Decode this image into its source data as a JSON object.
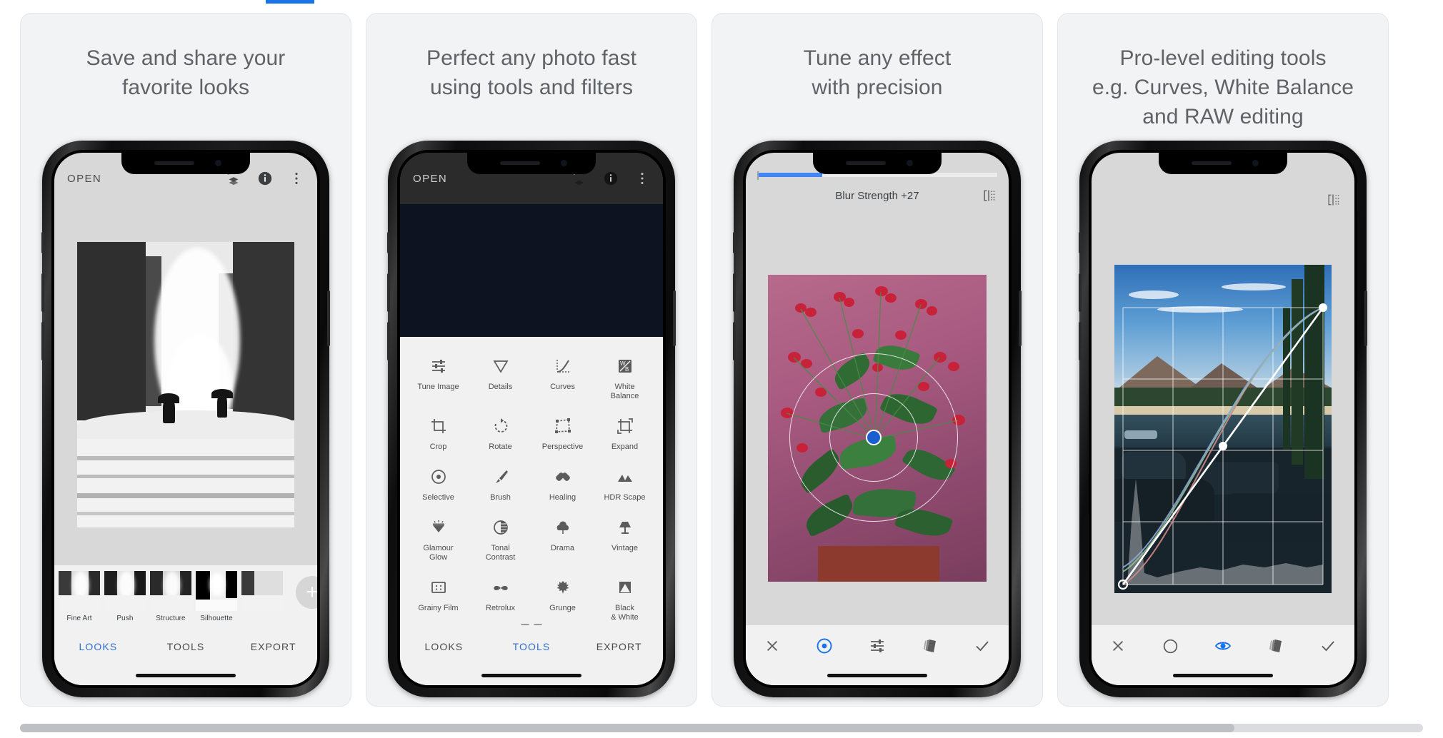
{
  "accent_color": "#1a73e8",
  "cards": [
    {
      "title": "Save and share your\nfavorite looks",
      "phone": {
        "top_bar": {
          "open_label": "OPEN",
          "icons": [
            "undo-stack-icon",
            "info-icon",
            "more-vert-icon"
          ]
        },
        "looks": [
          {
            "label": "Fine Art"
          },
          {
            "label": "Push"
          },
          {
            "label": "Structure"
          },
          {
            "label": "Silhouette"
          }
        ],
        "add_look_label": "+",
        "tabs": [
          {
            "label": "LOOKS",
            "active": true
          },
          {
            "label": "TOOLS",
            "active": false
          },
          {
            "label": "EXPORT",
            "active": false
          }
        ]
      }
    },
    {
      "title": "Perfect any photo fast\nusing tools and filters",
      "phone": {
        "top_bar": {
          "open_label": "OPEN",
          "icons": [
            "undo-stack-icon",
            "info-icon",
            "more-vert-icon"
          ]
        },
        "tools": [
          {
            "label": "Tune Image",
            "icon": "sliders-icon"
          },
          {
            "label": "Details",
            "icon": "triangle-down-icon"
          },
          {
            "label": "Curves",
            "icon": "curve-icon"
          },
          {
            "label": "White\nBalance",
            "icon": "wb-icon"
          },
          {
            "label": "Crop",
            "icon": "crop-icon"
          },
          {
            "label": "Rotate",
            "icon": "rotate-icon"
          },
          {
            "label": "Perspective",
            "icon": "perspective-icon"
          },
          {
            "label": "Expand",
            "icon": "expand-icon"
          },
          {
            "label": "Selective",
            "icon": "target-icon"
          },
          {
            "label": "Brush",
            "icon": "brush-icon"
          },
          {
            "label": "Healing",
            "icon": "healing-icon"
          },
          {
            "label": "HDR Scape",
            "icon": "mountains-icon"
          },
          {
            "label": "Glamour\nGlow",
            "icon": "glamour-icon"
          },
          {
            "label": "Tonal\nContrast",
            "icon": "contrast-icon"
          },
          {
            "label": "Drama",
            "icon": "cloud-icon"
          },
          {
            "label": "Vintage",
            "icon": "lamp-icon"
          },
          {
            "label": "Grainy Film",
            "icon": "grain-icon"
          },
          {
            "label": "Retrolux",
            "icon": "mustache-icon"
          },
          {
            "label": "Grunge",
            "icon": "grunge-icon"
          },
          {
            "label": "Black\n& White",
            "icon": "bw-icon"
          }
        ],
        "tabs": [
          {
            "label": "LOOKS",
            "active": false
          },
          {
            "label": "TOOLS",
            "active": true
          },
          {
            "label": "EXPORT",
            "active": false
          }
        ]
      }
    },
    {
      "title": "Tune any effect\nwith precision",
      "phone": {
        "adjust_label": "Blur Strength +27",
        "progress_percent": 27,
        "compare_icon": "compare-icon",
        "toolbar": [
          {
            "icon": "close-icon",
            "active": false
          },
          {
            "icon": "selective-target-icon",
            "active": true
          },
          {
            "icon": "sliders-icon",
            "active": false
          },
          {
            "icon": "stack-layers-icon",
            "active": false
          },
          {
            "icon": "check-icon",
            "active": false
          }
        ]
      }
    },
    {
      "title": "Pro-level editing tools\ne.g. Curves, White Balance\nand RAW editing",
      "phone": {
        "compare_icon": "compare-icon",
        "toolbar": [
          {
            "icon": "close-icon",
            "active": false
          },
          {
            "icon": "channel-circle-icon",
            "active": false
          },
          {
            "icon": "eye-icon",
            "active": true
          },
          {
            "icon": "stack-layers-icon",
            "active": false
          },
          {
            "icon": "check-icon",
            "active": false
          }
        ],
        "curves": {
          "channels": [
            "luminance",
            "red",
            "green",
            "blue"
          ],
          "control_points": [
            {
              "x": 0.0,
              "y": 0.0
            },
            {
              "x": 0.5,
              "y": 0.5
            },
            {
              "x": 1.0,
              "y": 1.0
            }
          ]
        }
      }
    }
  ],
  "scrollbar": {
    "present": true
  }
}
